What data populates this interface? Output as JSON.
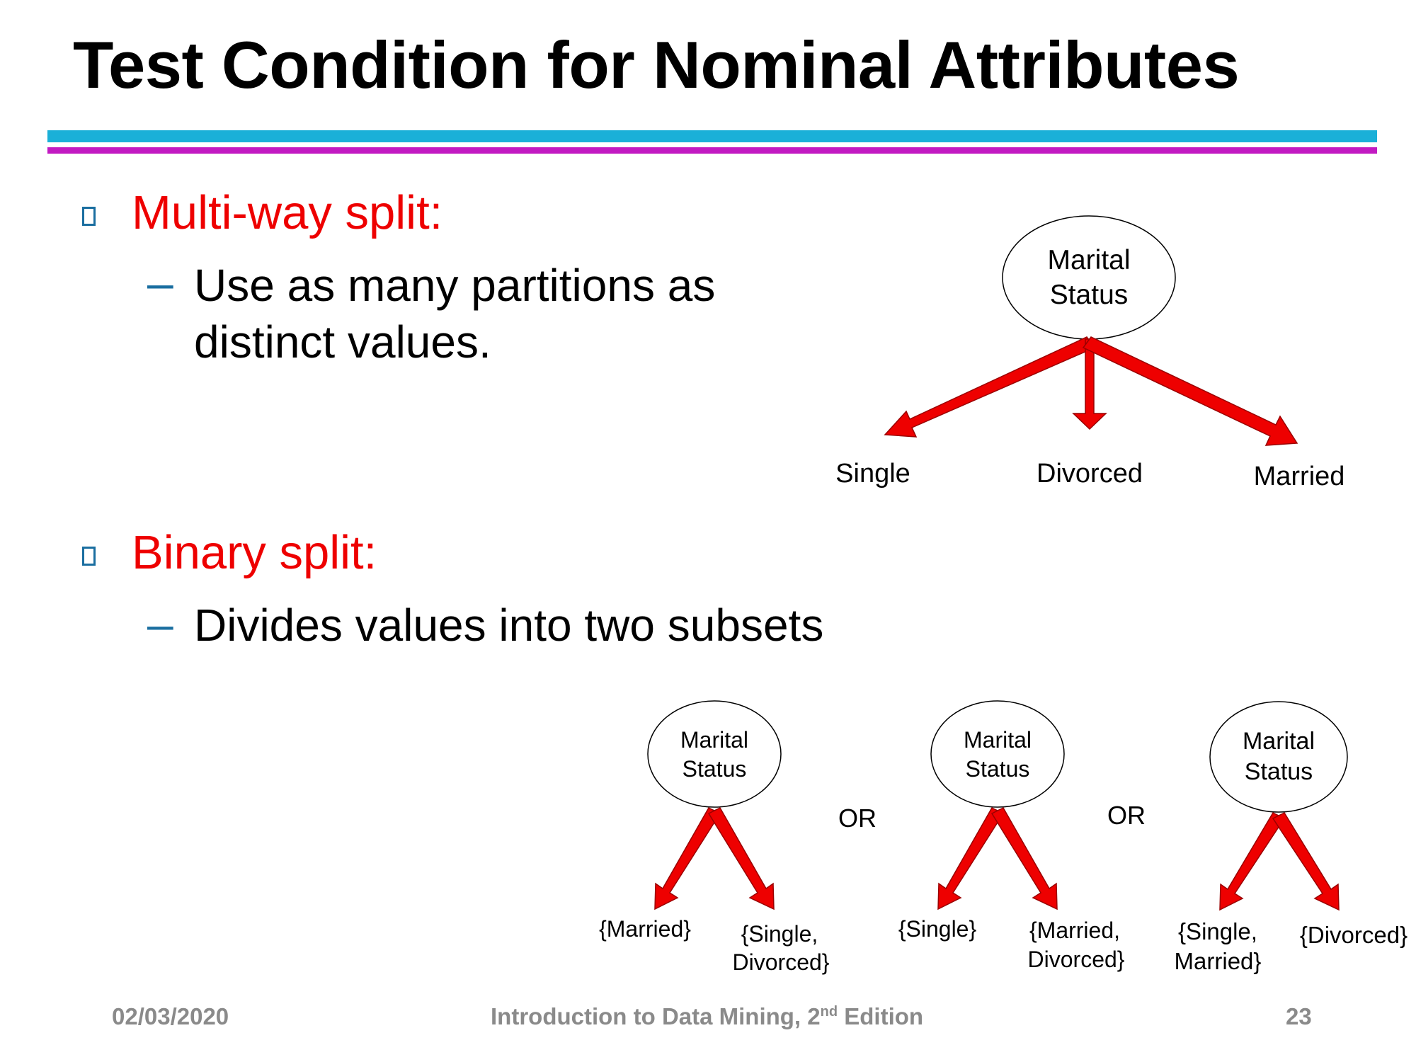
{
  "slide": {
    "title": "Test Condition for Nominal Attributes",
    "colors": {
      "accent_text": "#ee0000",
      "bullet": "#1a6ea0",
      "rule_top": "#1ab0d8",
      "rule_bottom": "#c21ac2",
      "arrow": "#ee0000"
    },
    "multiway": {
      "heading": "Multi-way split:",
      "point_line1": "Use as many partitions as",
      "point_line2": "distinct values."
    },
    "binary": {
      "heading": "Binary split:",
      "point": "Divides values into two subsets"
    },
    "dash": "–"
  },
  "diagram": {
    "multiway_tree": {
      "node_line1": "Marital",
      "node_line2": "Status",
      "branches": [
        "Single",
        "Divorced",
        "Married"
      ]
    },
    "binary_trees": [
      {
        "node_line1": "Marital",
        "node_line2": "Status",
        "left": [
          "{Married}"
        ],
        "right": [
          "{Single,",
          "Divorced}"
        ]
      },
      {
        "node_line1": "Marital",
        "node_line2": "Status",
        "left": [
          "{Single}"
        ],
        "right": [
          "{Married,",
          "Divorced}"
        ]
      },
      {
        "node_line1": "Marital",
        "node_line2": "Status",
        "left": [
          "{Single,",
          "Married}"
        ],
        "right": [
          "{Divorced}"
        ]
      }
    ],
    "separators": [
      "OR",
      "OR"
    ]
  },
  "footer": {
    "date": "02/03/2020",
    "book": "Introduction to Data Mining, 2",
    "book_sup": "nd",
    "book_tail": " Edition",
    "page": "23"
  }
}
